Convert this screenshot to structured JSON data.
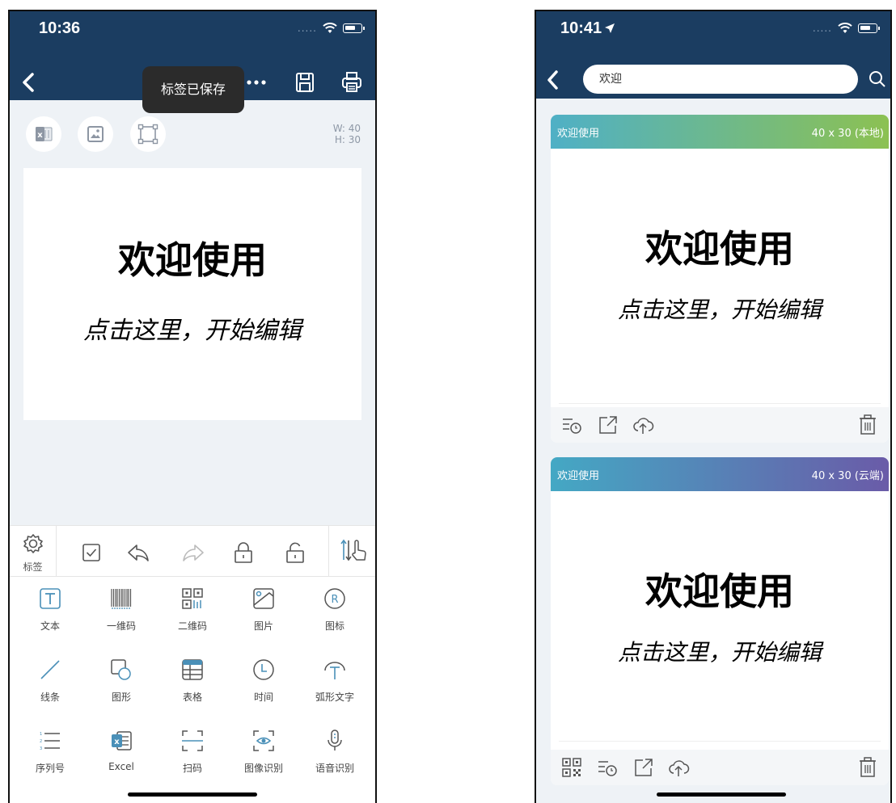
{
  "left": {
    "status_time": "10:36",
    "toast": "标签已保存",
    "dims": {
      "w": "W: 40",
      "h": "H: 30"
    },
    "label": {
      "title": "欢迎使用",
      "subtitle": "点击这里，开始编辑"
    },
    "toolbar": {
      "settings_label": "标签"
    },
    "tools": [
      {
        "label": "文本",
        "icon": "text-icon"
      },
      {
        "label": "一维码",
        "icon": "barcode-icon"
      },
      {
        "label": "二维码",
        "icon": "qrcode-icon"
      },
      {
        "label": "图片",
        "icon": "image-icon"
      },
      {
        "label": "图标",
        "icon": "registered-icon"
      },
      {
        "label": "线条",
        "icon": "line-icon"
      },
      {
        "label": "图形",
        "icon": "shape-icon"
      },
      {
        "label": "表格",
        "icon": "table-icon"
      },
      {
        "label": "时间",
        "icon": "clock-icon"
      },
      {
        "label": "弧形文字",
        "icon": "arc-text-icon"
      },
      {
        "label": "序列号",
        "icon": "serial-icon"
      },
      {
        "label": "Excel",
        "icon": "excel-icon"
      },
      {
        "label": "扫码",
        "icon": "scan-icon"
      },
      {
        "label": "图像识别",
        "icon": "image-recognition-icon"
      },
      {
        "label": "语音识别",
        "icon": "microphone-icon"
      }
    ]
  },
  "right": {
    "status_time": "10:41",
    "search_value": "欢迎",
    "cards": [
      {
        "name": "欢迎使用",
        "size": "40 x 30 (本地)",
        "title": "欢迎使用",
        "subtitle": "点击这里，开始编辑",
        "gradient": [
          "#4fb0c6",
          "#8cc152"
        ]
      },
      {
        "name": "欢迎使用",
        "size": "40 x 30 (云端)",
        "title": "欢迎使用",
        "subtitle": "点击这里，开始编辑",
        "gradient": [
          "#44a8c4",
          "#6a5ba8"
        ]
      }
    ]
  },
  "colors": {
    "navbar": "#1b3d61",
    "accent": "#4a90b8",
    "toast": "#2b2b2b"
  }
}
